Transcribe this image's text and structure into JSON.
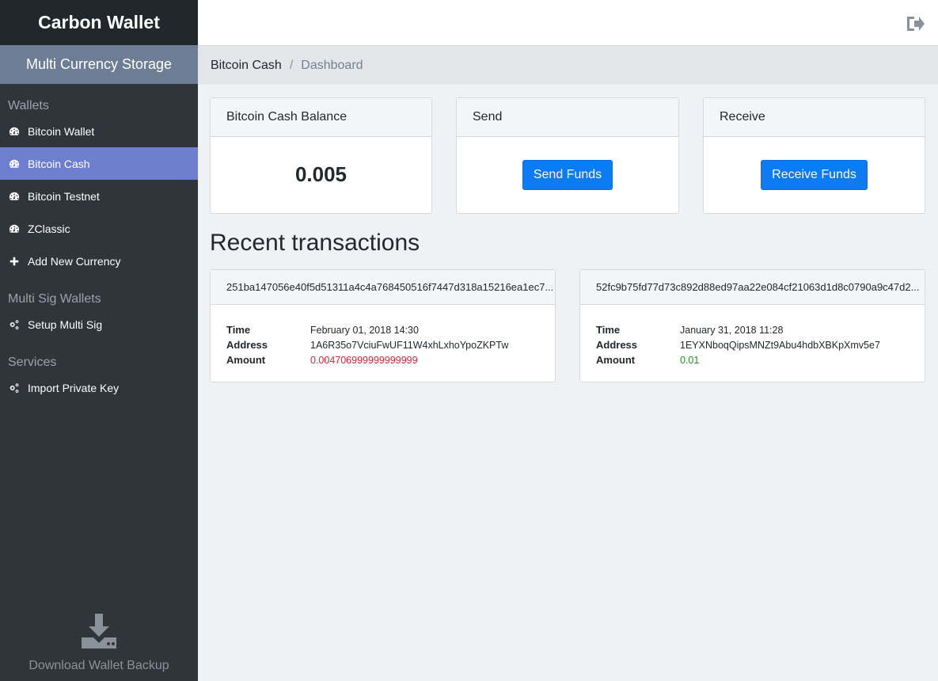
{
  "app": {
    "brand": "Carbon Wallet",
    "subtitle": "Multi Currency Storage"
  },
  "sidebar": {
    "sections": [
      {
        "title": "Wallets",
        "items": [
          {
            "label": "Bitcoin Wallet",
            "icon": "dashboard-icon",
            "active": false
          },
          {
            "label": "Bitcoin Cash",
            "icon": "dashboard-icon",
            "active": true
          },
          {
            "label": "Bitcoin Testnet",
            "icon": "dashboard-icon",
            "active": false
          },
          {
            "label": "ZClassic",
            "icon": "dashboard-icon",
            "active": false
          },
          {
            "label": "Add New Currency",
            "icon": "plus-icon",
            "active": false
          }
        ]
      },
      {
        "title": "Multi Sig Wallets",
        "items": [
          {
            "label": "Setup Multi Sig",
            "icon": "gears-icon",
            "active": false
          }
        ]
      },
      {
        "title": "Services",
        "items": [
          {
            "label": "Import Private Key",
            "icon": "gears-icon",
            "active": false
          }
        ]
      }
    ],
    "backup_label": "Download Wallet Backup",
    "backup_icon": "download-icon"
  },
  "header": {
    "logout_icon": "sign-out-icon"
  },
  "breadcrumb": {
    "parent": "Bitcoin Cash",
    "separator": "/",
    "current": "Dashboard"
  },
  "cards": {
    "balance": {
      "title": "Bitcoin Cash Balance",
      "value": "0.005"
    },
    "send": {
      "title": "Send",
      "button": "Send Funds"
    },
    "receive": {
      "title": "Receive",
      "button": "Receive Funds"
    }
  },
  "transactions": {
    "title": "Recent transactions",
    "labels": {
      "time": "Time",
      "address": "Address",
      "amount": "Amount"
    },
    "items": [
      {
        "hash": "251ba147056e40f5d51311a4c4a768450516f7447d318a15216ea1ec7...",
        "time": "February 01, 2018 14:30",
        "address": "1A6R35o7VciuFwUF11W4xhLxhoYpoZKPTw",
        "amount": "0.004706999999999999",
        "amount_color": "#e0242f"
      },
      {
        "hash": "52fc9b75fd77d73c892d88ed97aa22e084cf21063d1d8c0790a9c47d2...",
        "time": "January 31, 2018 11:28",
        "address": "1EYXNboqQipsMNZt9Abu4hdbXBKpXmv5e7",
        "amount": "0.01",
        "amount_color": "#2a8a2a"
      }
    ]
  },
  "colors": {
    "sidebar_bg": "#2f353a",
    "active_item": "#6e7fd0",
    "primary_button": "#0d7bf4"
  }
}
